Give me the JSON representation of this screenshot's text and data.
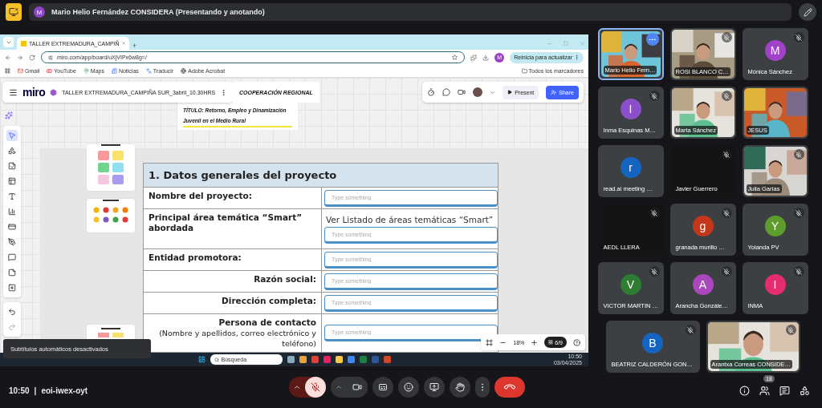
{
  "presenter_banner": {
    "initial": "M",
    "text": "Mario Helio Fernández CONSIDERA (Presentando y anotando)"
  },
  "browser": {
    "tab_title": "TALLER EXTREMADURA_CAMPIÑ",
    "new_tab": "+",
    "url": "miro.com/app/board/uXjVIPx6w8g=/",
    "update_button": "Reinicia para actualizar",
    "profile_initial": "M",
    "bookmarks": [
      "Gmail",
      "YouTube",
      "Maps",
      "Noticias",
      "Traducir",
      "Adobe Acrobat"
    ],
    "all_bookmarks": "Todos los marcadores"
  },
  "miro": {
    "logo": "miro",
    "board_name": "TALLER EXTREMADURA_CAMPIÑA SUR_3abril_10.30HRS",
    "frame_label": "COOPERACIÓN REGIONAL",
    "present": "Present",
    "share": "Share",
    "title_card": "TÍTULO: Retorno, Empleo y Dinamización Juvenil en el Medio Rural",
    "table": {
      "heading": "1. Datos generales del proyecto",
      "rows": [
        {
          "label": "Nombre del proyecto:",
          "right_aligned": false,
          "placeholder": "Type something"
        },
        {
          "label": "Principal área temática “Smart” abordada",
          "right_aligned": false,
          "value": "Ver Listado de áreas temáticas “Smart”",
          "placeholder": "Type something"
        },
        {
          "label": "Entidad promotora:",
          "right_aligned": false,
          "placeholder": "Type something"
        },
        {
          "label": "Razón social:",
          "right_aligned": true,
          "placeholder": "Type something"
        },
        {
          "label": "Dirección completa:",
          "right_aligned": true,
          "placeholder": "Type something"
        },
        {
          "label": "Persona de contacto",
          "note": "(Nombre y apellidos, correo electrónico y teléfono)",
          "right_aligned": true,
          "placeholder": "Type something"
        }
      ]
    },
    "zoom": "18%",
    "frames": "6/9"
  },
  "taskbar": {
    "search": "Búsqueda",
    "time": "10:50",
    "date": "03/04/2025"
  },
  "caption_toast": "Subtítulos automáticos desactivados",
  "participants": [
    {
      "name": "Mario Helio Fern…",
      "kind": "video",
      "muted": false,
      "highlighted": true
    },
    {
      "name": "ROSI BLANCO C…",
      "kind": "video",
      "muted": true,
      "highlighted": false
    },
    {
      "name": "Mónica Sánchez",
      "kind": "avatar",
      "initial": "M",
      "color": "#a142c8",
      "muted": true,
      "highlighted": false
    },
    {
      "name": "Inma Esquinas M…",
      "kind": "avatar",
      "initial": "I",
      "color": "#8a4fc9",
      "muted": true,
      "highlighted": false
    },
    {
      "name": "Marta Sánchez",
      "kind": "video",
      "muted": true,
      "highlighted": false
    },
    {
      "name": "JESUS",
      "kind": "video",
      "muted": false,
      "highlighted": false
    },
    {
      "name": "read.ai meeting …",
      "kind": "avatar",
      "initial": "r",
      "color": "#1565c0",
      "muted": false,
      "highlighted": false
    },
    {
      "name": "Javier Guerrero",
      "kind": "dark",
      "muted": true,
      "highlighted": false
    },
    {
      "name": "Julia Garías",
      "kind": "video",
      "muted": true,
      "highlighted": false
    },
    {
      "name": "AEDL LLERA",
      "kind": "dark",
      "muted": true,
      "highlighted": false
    },
    {
      "name": "granada murillo …",
      "kind": "avatar",
      "initial": "g",
      "color": "#c5361a",
      "muted": true,
      "highlighted": false
    },
    {
      "name": "Yolanda PV",
      "kind": "avatar",
      "initial": "Y",
      "color": "#5e9c2e",
      "muted": true,
      "highlighted": false
    },
    {
      "name": "VICTOR MARTIN …",
      "kind": "avatar",
      "initial": "V",
      "color": "#2e7d32",
      "muted": true,
      "highlighted": false
    },
    {
      "name": "Arancha Gonzále…",
      "kind": "avatar",
      "initial": "A",
      "color": "#ab47bc",
      "muted": true,
      "highlighted": false
    },
    {
      "name": "INMA",
      "kind": "avatar",
      "initial": "I",
      "color": "#e52d6e",
      "muted": true,
      "highlighted": false
    },
    {
      "name": "BEATRIZ CALDERÓN GON…",
      "kind": "avatar",
      "initial": "B",
      "color": "#1565c0",
      "muted": true,
      "highlighted": false
    },
    {
      "name": "Arantxa Correas CONSIDE…",
      "kind": "video",
      "muted": true,
      "highlighted": false
    }
  ],
  "bottom_bar": {
    "time": "10:50",
    "separator": "|",
    "meeting_code": "eoi-iwex-oyt",
    "mic_muted": true,
    "people_count": "18"
  }
}
